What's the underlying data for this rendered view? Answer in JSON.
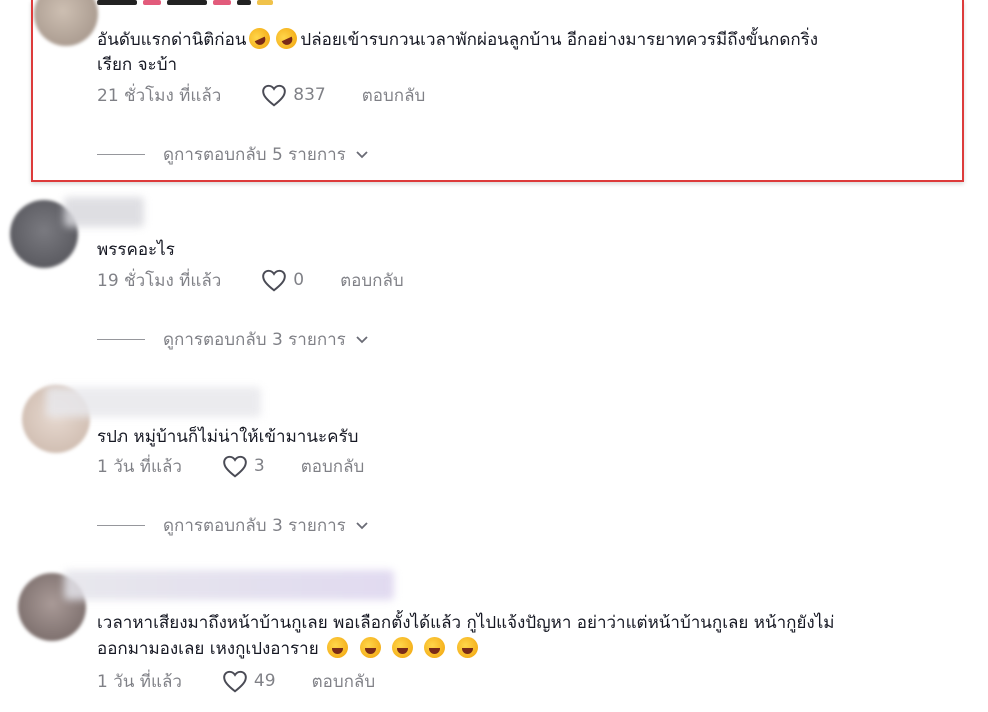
{
  "comments": [
    {
      "text_line1": "อันดับแรกด่านิติก่อน",
      "text_line1_after": "ปล่อยเข้ารบกวนเวลาพักผ่อนลูกบ้าน อีกอย่างมารยาทควรมีถึงขั้นกดกริ่ง",
      "text_line2": "เรียก จะบ้า",
      "time": "21 ชั่วโมง ที่แล้ว",
      "likes": "837",
      "reply_label": "ตอบกลับ",
      "view_replies": "ดูการตอบกลับ 5 รายการ"
    },
    {
      "text_line1": "พรรคอะไร",
      "time": "19 ชั่วโมง ที่แล้ว",
      "likes": "0",
      "reply_label": "ตอบกลับ",
      "view_replies": "ดูการตอบกลับ 3 รายการ"
    },
    {
      "text_line1": "รปภ หมู่บ้านก็ไม่น่าให้เข้ามานะครับ",
      "time": "1 วัน ที่แล้ว",
      "likes": "3",
      "reply_label": "ตอบกลับ",
      "view_replies": "ดูการตอบกลับ 3 รายการ"
    },
    {
      "text_line1": "เวลาหาเสียงมาถึงหน้าบ้านกูเลย พอเลือกตั้งได้แล้ว กูไปแจ้งปัญหา อย่าว่าแต่หน้าบ้านกูเลย หน้ากูยังไม่",
      "text_line2": "ออกมามองเลย เหงกูเปงอาราย",
      "time": "1 วัน ที่แล้ว",
      "likes": "49",
      "reply_label": "ตอบกลับ"
    }
  ],
  "icons": {
    "like": "heart-outline-icon",
    "expand": "chevron-down-icon",
    "emoji_rofl": "rolling-on-floor-laughing-emoji",
    "emoji_grin": "grinning-squinting-face-emoji"
  },
  "colors": {
    "highlight": "#dd3b3b",
    "text": "#161823",
    "secondary": "rgba(22,24,35,0.55)"
  }
}
